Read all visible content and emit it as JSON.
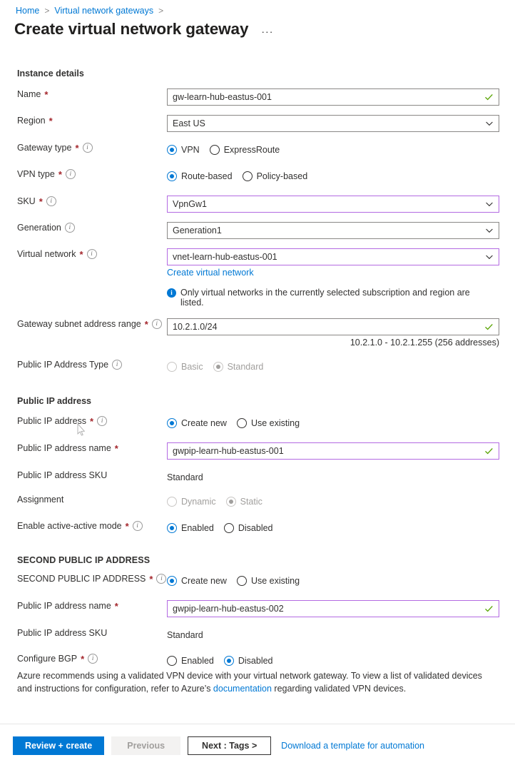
{
  "breadcrumb": {
    "items": [
      {
        "label": "Home"
      },
      {
        "label": "Virtual network gateways"
      }
    ],
    "separator": ">"
  },
  "header": {
    "title": "Create virtual network gateway",
    "more_label": "···"
  },
  "sections": {
    "instance_details": "Instance details",
    "public_ip_address": "Public IP address",
    "second_public_ip_address": "SECOND PUBLIC IP ADDRESS"
  },
  "fields": {
    "name": {
      "label": "Name",
      "value": "gw-learn-hub-eastus-001",
      "required": true,
      "valid": true
    },
    "region": {
      "label": "Region",
      "value": "East US",
      "required": true
    },
    "gateway_type": {
      "label": "Gateway type",
      "required": true,
      "options": [
        "VPN",
        "ExpressRoute"
      ],
      "selected": "VPN"
    },
    "vpn_type": {
      "label": "VPN type",
      "required": true,
      "options": [
        "Route-based",
        "Policy-based"
      ],
      "selected": "Route-based"
    },
    "sku": {
      "label": "SKU",
      "value": "VpnGw1",
      "required": true
    },
    "generation": {
      "label": "Generation",
      "value": "Generation1",
      "required": false
    },
    "virtual_network": {
      "label": "Virtual network",
      "value": "vnet-learn-hub-eastus-001",
      "required": true,
      "create_link": "Create virtual network",
      "info": "Only virtual networks in the currently selected subscription and region are listed."
    },
    "gateway_subnet": {
      "label": "Gateway subnet address range",
      "value": "10.2.1.0/24",
      "required": true,
      "hint": "10.2.1.0 - 10.2.1.255 (256 addresses)",
      "valid": true
    },
    "public_ip_address_type": {
      "label": "Public IP Address Type",
      "required": false,
      "disabled": true,
      "options": [
        "Basic",
        "Standard"
      ],
      "selected": "Standard"
    },
    "public_ip_address": {
      "label": "Public IP address",
      "required": true,
      "options": [
        "Create new",
        "Use existing"
      ],
      "selected": "Create new"
    },
    "public_ip_name": {
      "label": "Public IP address name",
      "value": "gwpip-learn-hub-eastus-001",
      "required": true,
      "valid": true
    },
    "public_ip_sku": {
      "label": "Public IP address SKU",
      "value": "Standard"
    },
    "assignment": {
      "label": "Assignment",
      "disabled": true,
      "options": [
        "Dynamic",
        "Static"
      ],
      "selected": "Static"
    },
    "active_active": {
      "label": "Enable active-active mode",
      "required": true,
      "options": [
        "Enabled",
        "Disabled"
      ],
      "selected": "Enabled"
    },
    "second_public_ip_address": {
      "label": "SECOND PUBLIC IP ADDRESS",
      "required": true,
      "options": [
        "Create new",
        "Use existing"
      ],
      "selected": "Create new"
    },
    "second_public_ip_name": {
      "label": "Public IP address name",
      "value": "gwpip-learn-hub-eastus-002",
      "required": true,
      "valid": true
    },
    "second_public_ip_sku": {
      "label": "Public IP address SKU",
      "value": "Standard"
    },
    "configure_bgp": {
      "label": "Configure BGP",
      "required": true,
      "options": [
        "Enabled",
        "Disabled"
      ],
      "selected": "Disabled"
    }
  },
  "note": {
    "text_before": "Azure recommends using a validated VPN device with your virtual network gateway. To view a list of validated devices and instructions for configuration, refer to Azure’s ",
    "link": "documentation",
    "text_after": " regarding validated VPN devices."
  },
  "footer": {
    "review_create": "Review + create",
    "previous": "Previous",
    "next": "Next : Tags >",
    "download_template": "Download a template for automation"
  },
  "colors": {
    "accent": "#0078d4",
    "required_asterisk": "#a4262c",
    "focus_border": "#b36ae2",
    "valid_check": "#57a300"
  }
}
